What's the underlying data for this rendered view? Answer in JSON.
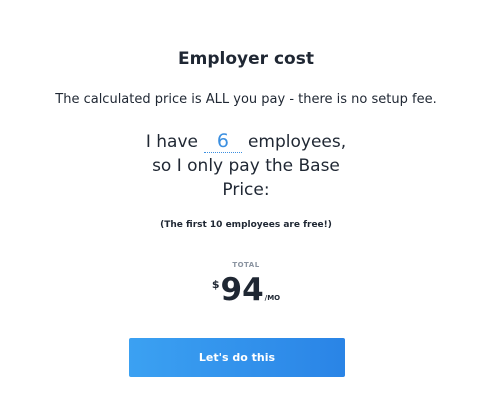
{
  "pricing": {
    "title": "Employer cost",
    "subtitle": "The calculated price is ALL you pay - there is no setup fee.",
    "calc": {
      "prefix": "I have",
      "employee_count": "6",
      "suffix": "employees,",
      "line2": "so I only pay the Base",
      "line3": "Price:"
    },
    "note": "(The first 10 employees are free!)",
    "total_label": "TOTAL",
    "currency": "$",
    "amount": "94",
    "period": "/MO",
    "cta_label": "Let's do this"
  },
  "colors": {
    "accent": "#3b8fe0",
    "button_start": "#3ba1f2",
    "button_end": "#2a84e6",
    "text": "#1f2733",
    "muted": "#8a93a0"
  }
}
